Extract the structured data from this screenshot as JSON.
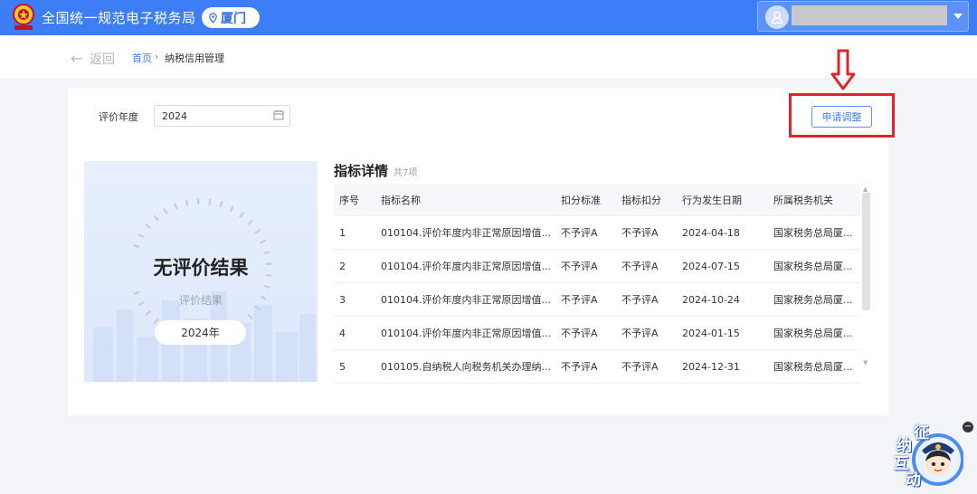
{
  "header": {
    "title": "全国统一规范电子税务局",
    "city": "厦门",
    "brand_color": "#3d7df5"
  },
  "breadcrumb": {
    "back_label": "返回",
    "home": "首页",
    "separator": "›",
    "current": "纳税信用管理"
  },
  "filter": {
    "year_label": "评价年度",
    "year_value": "2024",
    "apply_button": "申请调整"
  },
  "result": {
    "title": "无评价结果",
    "subtitle": "评价结果",
    "year": "2024年"
  },
  "details": {
    "title": "指标详情",
    "count": "共7项",
    "columns": [
      "序号",
      "指标名称",
      "扣分标准",
      "指标扣分",
      "行为发生日期",
      "所属税务机关"
    ],
    "rows": [
      [
        "1",
        "010104.评价年度内非正常原因增值...",
        "不予评A",
        "不予评A",
        "2024-04-18",
        "国家税务总局厦..."
      ],
      [
        "2",
        "010104.评价年度内非正常原因增值...",
        "不予评A",
        "不予评A",
        "2024-07-15",
        "国家税务总局厦..."
      ],
      [
        "3",
        "010104.评价年度内非正常原因增值...",
        "不予评A",
        "不予评A",
        "2024-10-24",
        "国家税务总局厦..."
      ],
      [
        "4",
        "010104.评价年度内非正常原因增值...",
        "不予评A",
        "不予评A",
        "2024-01-15",
        "国家税务总局厦..."
      ],
      [
        "5",
        "010105.自纳税人向税务机关办理纳...",
        "不予评A",
        "不予评A",
        "2024-12-31",
        "国家税务总局厦..."
      ]
    ]
  },
  "mascot": {
    "chars": [
      "征",
      "纳",
      "互",
      "动"
    ],
    "close": "−"
  },
  "icons": [
    "emblem-icon",
    "location-pin-icon",
    "user-avatar-icon",
    "chevron-down-icon",
    "back-arrow-icon",
    "calendar-icon",
    "annotation-arrow-icon"
  ]
}
